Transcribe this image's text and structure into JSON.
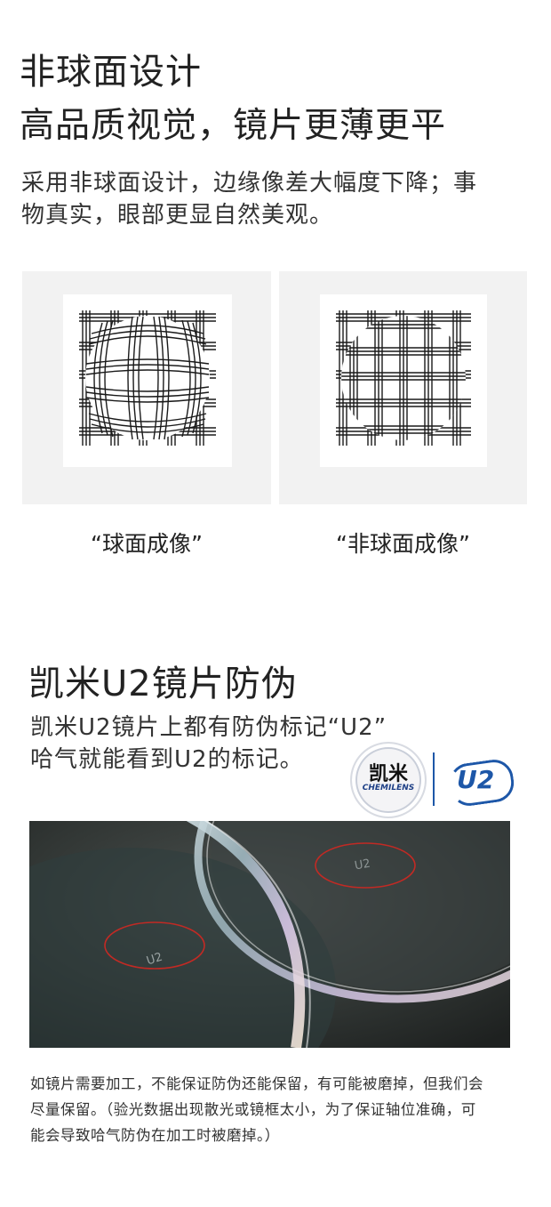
{
  "section1": {
    "title": "非球面设计",
    "subtitle": "高品质视觉，镜片更薄更平",
    "desc_line1": "采用非球面设计，边缘像差大幅度下降；事",
    "desc_line2": "物真实，眼部更显自然美观。",
    "comparison": [
      {
        "caption": "“球面成像”"
      },
      {
        "caption": "“非球面成像”"
      }
    ]
  },
  "section2": {
    "title": "凯米U2镜片防伪",
    "desc_line1": "凯米U2镜片上都有防伪标记“U2”",
    "desc_line2": "哈气就能看到U2的标记。",
    "logo": {
      "brand_cn": "凯米",
      "brand_en": "CHEMILENS",
      "mark": "U2"
    },
    "photo_marks": [
      "U2",
      "U2"
    ],
    "note_line1": "如镜片需要加工，不能保证防伪还能保留，有可能被磨掉，但我们会",
    "note_line2": "尽量保留。（验光数据出现散光或镜框太小，为了保证轴位准确，可",
    "note_line3": "能会导致哈气防伪在加工时被磨掉。）"
  },
  "colors": {
    "panel_bg": "#f2f2f2",
    "text": "#222222",
    "photo_bg": "#2b2f2d",
    "circle_red": "#c22a24",
    "logo_blue": "#1d57a8"
  }
}
